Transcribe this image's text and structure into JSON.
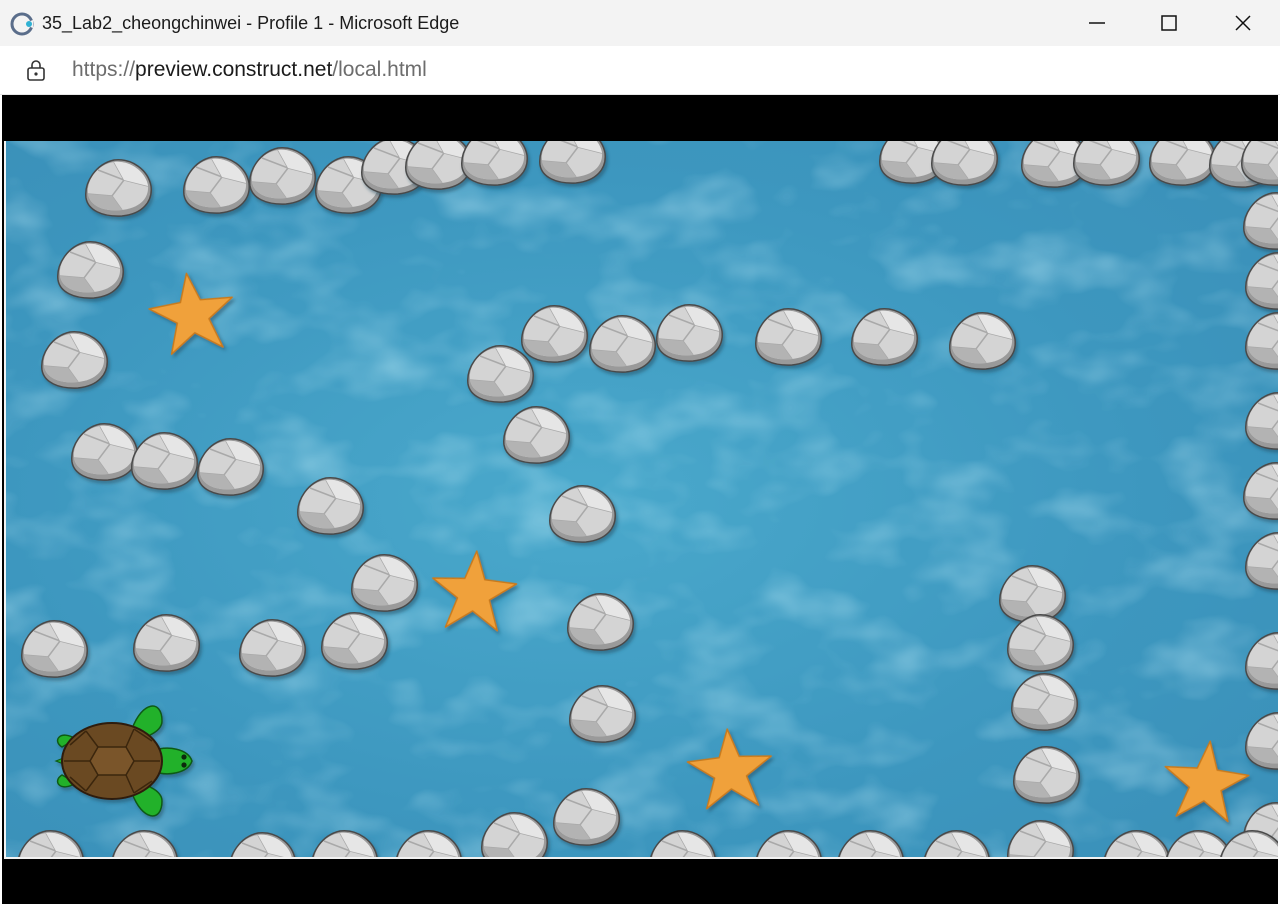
{
  "window": {
    "title": "35_Lab2_cheongchinwei - Profile 1 - Microsoft Edge",
    "app_icon": "edge-refresh-icon",
    "controls": [
      "minimize-icon",
      "maximize-icon",
      "close-icon"
    ]
  },
  "address_bar": {
    "icon": "lock-icon",
    "url_prefix": "https://",
    "url_host": "preview.construct.net",
    "url_path": "/local.html"
  },
  "game": {
    "background": "water",
    "player": "turtle",
    "colors": {
      "water": "#3f9fc4",
      "water_light": "#66c3dc",
      "rock": "#cfcfcf",
      "rock_shadow": "#8c8c8c",
      "starfish": "#f0a13a",
      "turtle_shell": "#6b4a22",
      "turtle_skin": "#25b02b"
    }
  }
}
